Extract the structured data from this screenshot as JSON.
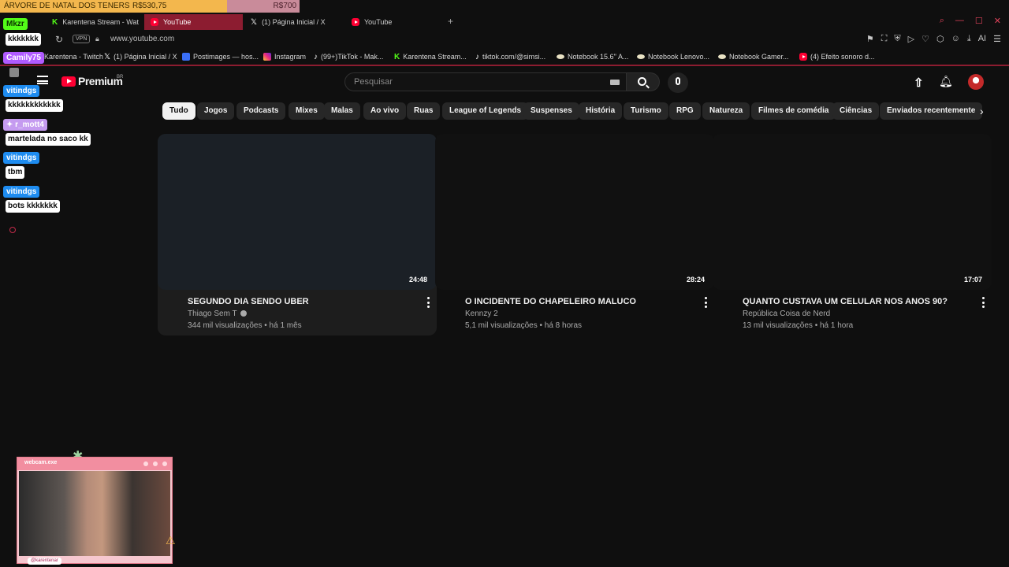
{
  "goal": {
    "title": "ÁRVORE DE NATAL DOS TENERS",
    "current": "R$530,75",
    "target": "R$700",
    "progress": 0.758
  },
  "browser": {
    "tabs": [
      {
        "label": "Karentena Stream - Watch",
        "icon": "kick-icon",
        "active": false
      },
      {
        "label": "YouTube",
        "icon": "youtube-icon",
        "active": true
      },
      {
        "label": "(1) Página Inicial / X",
        "icon": "x-icon",
        "active": false
      },
      {
        "label": "YouTube",
        "icon": "youtube-icon",
        "active": false
      }
    ],
    "new_tab": "+",
    "vpn_label": "VPN",
    "url": "www.youtube.com",
    "ai_label": "AI",
    "bookmarks": [
      {
        "label": "Karentena - Twitch",
        "icon": "twitch-icon"
      },
      {
        "label": "(1) Página Inicial / X",
        "icon": "x-icon"
      },
      {
        "label": "Postimages — hos...",
        "icon": "postimages-icon"
      },
      {
        "label": "Instagram",
        "icon": "instagram-icon"
      },
      {
        "label": "(99+)TikTok - Mak...",
        "icon": "tiktok-icon"
      },
      {
        "label": "Karentena Stream...",
        "icon": "kick-icon"
      },
      {
        "label": "tiktok.com/@simsi...",
        "icon": "tiktok-icon"
      },
      {
        "label": "Notebook 15.6'' A...",
        "icon": "notebook-icon"
      },
      {
        "label": "Notebook Lenovo...",
        "icon": "notebook-icon"
      },
      {
        "label": "Notebook Gamer...",
        "icon": "notebook-icon"
      },
      {
        "label": "(4) Efeito sonoro d...",
        "icon": "youtube-icon"
      }
    ]
  },
  "youtube": {
    "logo_text": "Premium",
    "region": "BR",
    "search_placeholder": "Pesquisar",
    "chips": [
      "Tudo",
      "Jogos",
      "Podcasts",
      "Mixes",
      "Malas",
      "Ao vivo",
      "Ruas",
      "League of Legends",
      "Suspenses",
      "História",
      "Turismo",
      "RPG",
      "Natureza",
      "Filmes de comédia",
      "Ciências",
      "Enviados recentemente"
    ],
    "videos": [
      {
        "title": "SEGUNDO DIA SENDO UBER",
        "channel": "Thiago Sem T",
        "verified": true,
        "meta": "344 mil visualizações • há 1 mês",
        "duration": "24:48"
      },
      {
        "title": "O INCIDENTE DO CHAPELEIRO MALUCO",
        "channel": "Kennzy 2",
        "verified": false,
        "meta": "5,1 mil visualizações • há 8 horas",
        "duration": "28:24"
      },
      {
        "title": "QUANTO CUSTAVA UM CELULAR NOS ANOS 90?",
        "channel": "República Coisa de Nerd",
        "verified": false,
        "meta": "13 mil visualizações • há 1 hora",
        "duration": "17:07"
      }
    ]
  },
  "chat": {
    "messages": [
      {
        "user": "Mkzr",
        "user_color": "#53fc18",
        "text": "kkkkkkk"
      },
      {
        "user": "Camily75",
        "user_color": "#b05bff",
        "text": ""
      },
      {
        "user": "vitindgs",
        "user_color": "#1e8cf0",
        "text": "kkkkkkkkkkkk"
      },
      {
        "user": "r_mott4",
        "user_color": "#c59bf0",
        "text": "martelada no saco kk"
      },
      {
        "user": "vitindgs",
        "user_color": "#1e8cf0",
        "text": "tbm"
      },
      {
        "user": "vitindgs",
        "user_color": "#1e8cf0",
        "text": "bots kkkkkkk"
      }
    ]
  },
  "webcam": {
    "title": "webcam.exe",
    "handle": "@karentenar"
  },
  "colors": {
    "accent": "#8c1c30",
    "yt_red": "#ff0033",
    "goal_fill": "#f3b74d",
    "goal_bg": "#c98b9a",
    "webcam_pink": "#f28ea0"
  }
}
